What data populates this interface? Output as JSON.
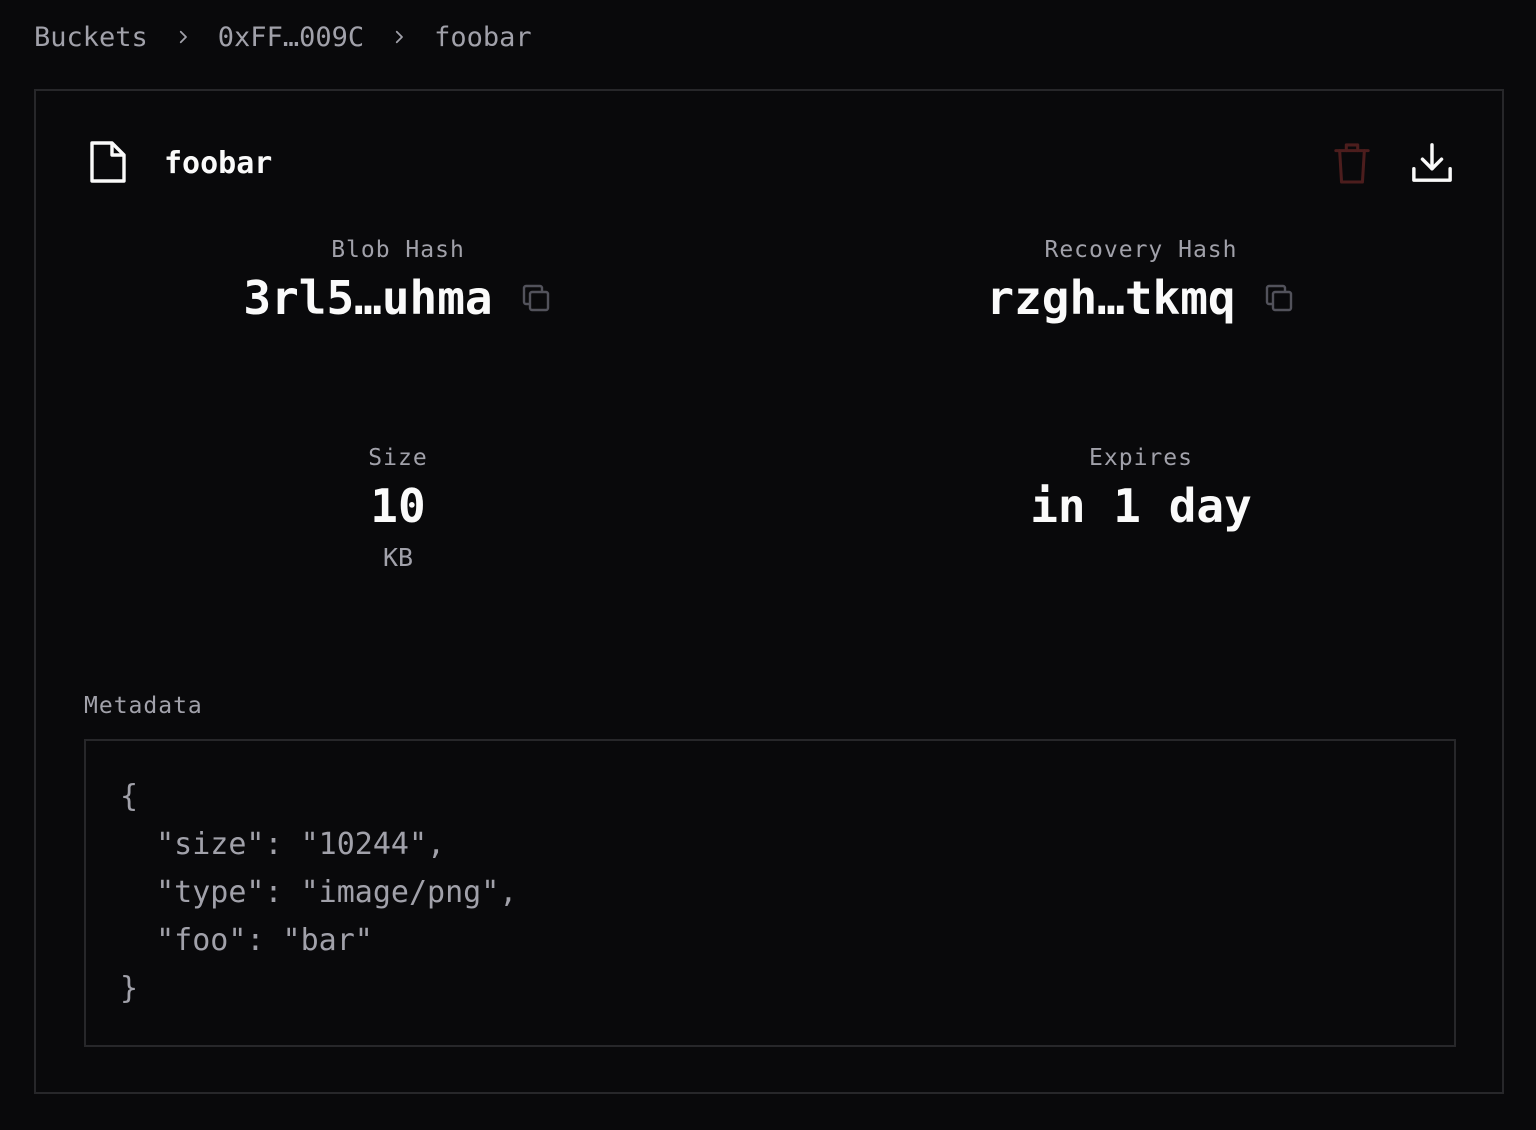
{
  "breadcrumb": {
    "items": [
      "Buckets",
      "0xFF…009C",
      "foobar"
    ]
  },
  "file": {
    "name": "foobar",
    "icon": "file-icon",
    "actions": {
      "delete_icon": "trash-icon",
      "download_icon": "download-icon"
    }
  },
  "stats": {
    "blob_hash": {
      "label": "Blob Hash",
      "value": "3rl5…uhma"
    },
    "recovery_hash": {
      "label": "Recovery Hash",
      "value": "rzgh…tkmq"
    },
    "size": {
      "label": "Size",
      "value": "10",
      "unit": "KB"
    },
    "expires": {
      "label": "Expires",
      "value": "in 1 day"
    }
  },
  "metadata": {
    "label": "Metadata",
    "lines": [
      "{",
      "  \"size\": \"10244\",",
      "  \"type\": \"image/png\",",
      "  \"foo\": \"bar\"",
      "}"
    ]
  },
  "colors": {
    "background": "#09090b",
    "border": "#27272a",
    "text_primary": "#fafafa",
    "text_muted": "#a1a1aa",
    "danger_muted": "#4c1d1d"
  }
}
